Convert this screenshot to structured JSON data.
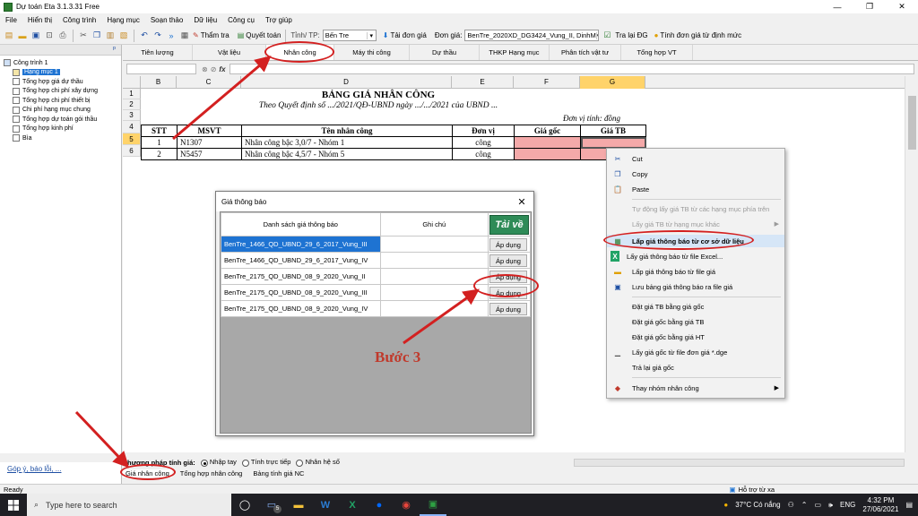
{
  "window": {
    "title": "Dự toán Eta 3.1.3.31 Free",
    "controls": [
      "—",
      "❐",
      "✕"
    ]
  },
  "menu": [
    "File",
    "Hiển thị",
    "Công trình",
    "Hạng mục",
    "Soạn thảo",
    "Dữ liệu",
    "Công cụ",
    "Trợ giúp"
  ],
  "toolbar": {
    "tham_tra": "Thẩm tra",
    "quyet_toan": "Quyết toán",
    "tinh_tp_label": "Tỉnh/ TP:",
    "tinh_tp_value": "Bến Tre",
    "tai_don_gia": "Tải đơn giá",
    "don_gia_label": "Đơn giá:",
    "don_gia_value": "BenTre_2020XD_DG3424_Vung_II, DinhM",
    "tra_lai_dg": "Tra lại ĐG",
    "tinh_don_gia": "Tính đơn giá từ định mức"
  },
  "left_panel": {
    "pin": "ᵖ",
    "items": [
      {
        "label": "Công trình 1",
        "level": 0
      },
      {
        "label": "Hạng mục 1",
        "level": 1,
        "selected": true
      },
      {
        "label": "Tổng hợp giá dự thầu",
        "level": 1
      },
      {
        "label": "Tổng hợp chi phí xây dựng",
        "level": 1
      },
      {
        "label": "Tổng hợp chi phí thiết bị",
        "level": 1
      },
      {
        "label": "Chi phí hạng mục chung",
        "level": 1
      },
      {
        "label": "Tổng hợp dự toán gói thầu",
        "level": 1
      },
      {
        "label": "Tổng hợp kinh phí",
        "level": 1
      },
      {
        "label": "Bìa",
        "level": 1
      }
    ],
    "feedback_link": "Góp ý, báo lỗi, ..."
  },
  "tabs": [
    "Tiên lượng",
    "Vật liệu",
    "Nhân công",
    "Máy thi công",
    "Dự thầu",
    "THKP Hạng mục",
    "Phân tích vật tư",
    "Tổng hợp VT"
  ],
  "active_tab": "Nhân công",
  "formula_bar": {
    "fx": "fx"
  },
  "sheet": {
    "columns": [
      "B",
      "C",
      "D",
      "E",
      "F",
      "G"
    ],
    "rows": [
      "1",
      "2",
      "3",
      "4",
      "5",
      "6"
    ],
    "title": "BẢNG GIÁ NHÂN CÔNG",
    "subtitle": "Theo Quyết định số .../2021/QĐ-UBND ngày .../.../2021 của UBND ...",
    "unit": "Đơn vị tính: đồng",
    "headers": [
      "STT",
      "MSVT",
      "Tên nhân công",
      "Đơn vị",
      "Giá gốc",
      "Giá TB"
    ],
    "data": [
      {
        "stt": "1",
        "msvt": "N1307",
        "ten": "Nhân công bậc 3,0/7 - Nhóm 1",
        "dv": "công"
      },
      {
        "stt": "2",
        "msvt": "N5457",
        "ten": "Nhân công bậc 4,5/7 - Nhóm 5",
        "dv": "công"
      }
    ]
  },
  "dialog": {
    "title": "Giá thông báo",
    "col_list": "Danh sách giá thông báo",
    "col_note": "Ghi chú",
    "download_btn": "Tải về",
    "apply_label": "Áp dụng",
    "rows": [
      "BenTre_1466_QD_UBND_29_6_2017_Vung_III",
      "BenTre_1466_QD_UBND_29_6_2017_Vung_IV",
      "BenTre_2175_QD_UBND_08_9_2020_Vung_II",
      "BenTre_2175_QD_UBND_08_9_2020_Vung_III",
      "BenTre_2175_QD_UBND_08_9_2020_Vung_IV"
    ]
  },
  "annotation": {
    "step": "Bước 3"
  },
  "context_menu": {
    "items": [
      {
        "label": "Cut",
        "icon": "scissors-icon",
        "glyph": "✂"
      },
      {
        "label": "Copy",
        "icon": "copy-icon",
        "glyph": "❐"
      },
      {
        "label": "Paste",
        "icon": "paste-icon",
        "glyph": "📋"
      },
      {
        "label": "Tự động lấy giá TB từ các hạng mục phía trên",
        "disabled": true
      },
      {
        "label": "Lấy giá TB từ hạng mục khác",
        "disabled": true,
        "sub": true
      },
      {
        "label": "Lấp giá thông báo từ cơ sở dữ liệu",
        "icon": "database-icon",
        "glyph": "▦",
        "highlight": true
      },
      {
        "label": "Lấy giá thông báo từ file Excel...",
        "icon": "excel-icon",
        "glyph": "X"
      },
      {
        "label": "Lấp giá thông báo từ file giá",
        "icon": "folder-icon",
        "glyph": "▬"
      },
      {
        "label": "Lưu bảng giá thông báo ra file giá",
        "icon": "save-icon",
        "glyph": "▣"
      },
      {
        "label": "Đặt giá TB bằng giá gốc"
      },
      {
        "label": "Đặt giá gốc bằng giá TB"
      },
      {
        "label": "Đặt giá gốc bằng giá HT"
      },
      {
        "label": "Lấy giá gốc từ file đơn giá *.dge",
        "icon": "import-icon",
        "glyph": "▁"
      },
      {
        "label": "Trả lại giá gốc"
      },
      {
        "label": "Thay nhóm nhân công",
        "icon": "group-icon",
        "glyph": "◆",
        "sub": true
      }
    ]
  },
  "bottom": {
    "method_label": "Phương pháp tính giá:",
    "methods": [
      "Nhập tay",
      "Tính trực tiếp",
      "Nhân hệ số"
    ],
    "selected_method": "Nhập tay",
    "sheet_tabs": [
      "Giá nhân công",
      "Tổng hợp nhân công",
      "Bảng tính giá NC"
    ],
    "active_sheet": "Giá nhân công"
  },
  "status": {
    "text": "Ready",
    "help": "Hỗ trợ từ xa"
  },
  "taskbar": {
    "search": "Type here to search",
    "weather": "37°C Có nắng",
    "lang": "ENG",
    "time": "4:32 PM",
    "date": "27/06/2021",
    "badge": "5"
  },
  "colors": {
    "accent": "#1e73d2",
    "pink": "#f4a9a9",
    "annotation": "#d32020",
    "selected_header": "#ffd36a"
  }
}
